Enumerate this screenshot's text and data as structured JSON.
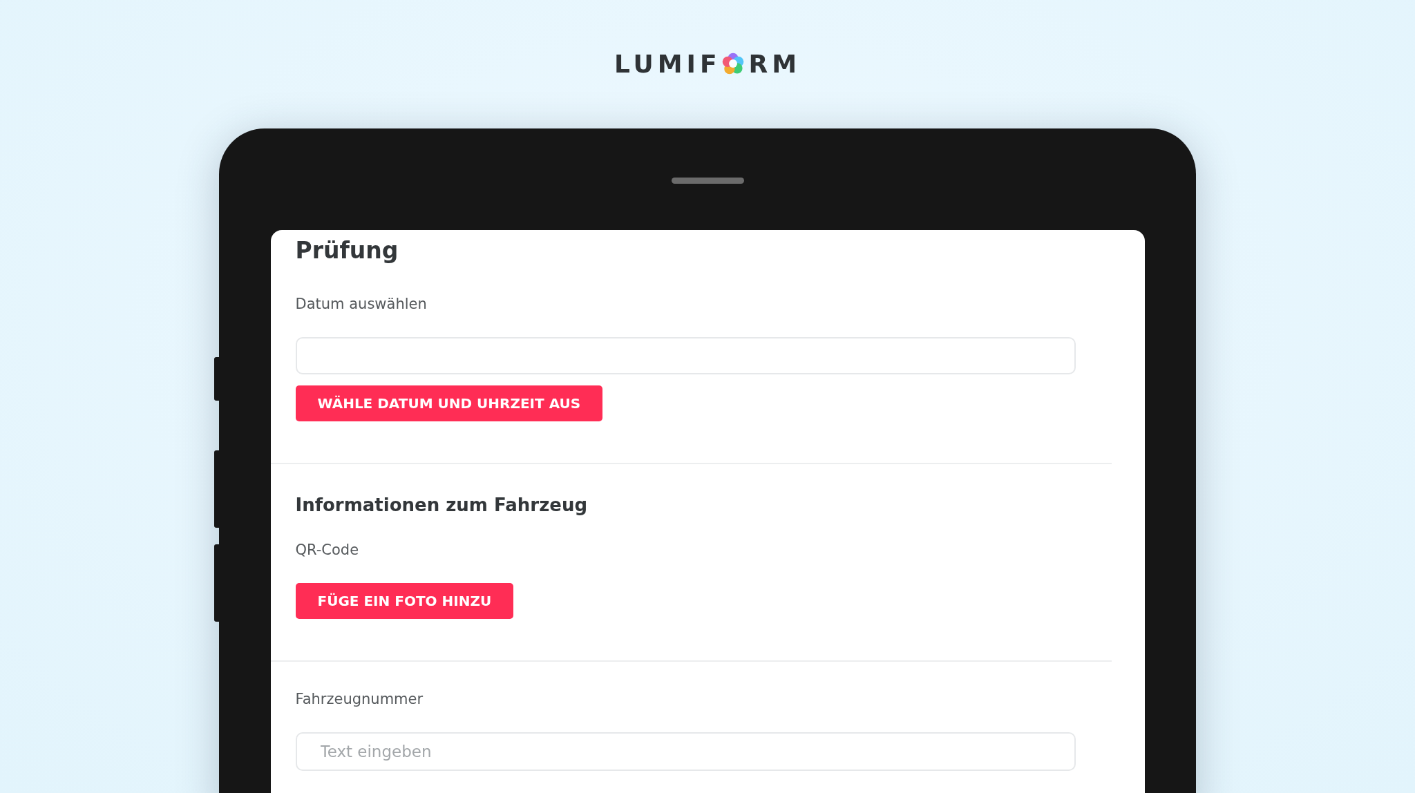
{
  "logo": {
    "text_before": "LUMIF",
    "text_after": "RM"
  },
  "form": {
    "title": "Prüfung",
    "sections": [
      {
        "kind": "date",
        "label": "Datum auswählen",
        "button": "WÄHLE DATUM UND UHRZEIT AUS"
      },
      {
        "kind": "photo",
        "heading": "Informationen zum Fahrzeug",
        "label": "QR-Code",
        "button": "FÜGE EIN FOTO HINZU"
      },
      {
        "kind": "text",
        "label": "Fahrzeugnummer",
        "placeholder": "Text eingeben"
      }
    ]
  }
}
